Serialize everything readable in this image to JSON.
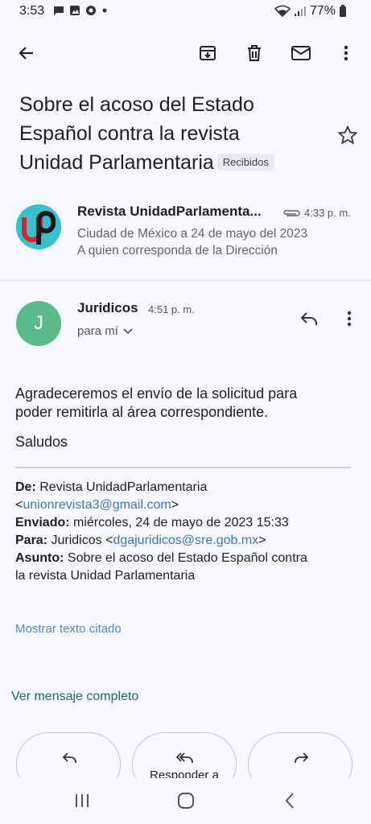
{
  "status": {
    "time": "3:53",
    "battery": "77%"
  },
  "toolbar": {
    "back": "arrow-back-icon",
    "archive": "archive-icon",
    "delete": "trash-icon",
    "mark_unread": "mail-icon",
    "more": "more-vert-icon"
  },
  "subject": {
    "lines": [
      "Sobre el acoso del Estado",
      "Español  contra  la revista",
      "Unidad Parlamentaria"
    ],
    "label": "Recibidos"
  },
  "message1": {
    "sender": "Revista UnidadParlamenta...",
    "time": "4:33 p. m.",
    "snippet_line1": "Ciudad de México a 24 de mayo del 2023",
    "snippet_line2": "A quien corresponda de la Dirección"
  },
  "message2": {
    "avatar_letter": "J",
    "sender": "Juridicos",
    "time": "4:51 p. m.",
    "to": "para mí",
    "body_line1": "Agradeceremos el envío de la solicitud para",
    "body_line2": "poder remitirla al área correspondiente.",
    "greeting": "Saludos",
    "quote": {
      "from_label": "De:",
      "from_name": "Revista UnidadParlamentaria",
      "from_email": "unionrevista3@gmail.com",
      "sent_label": "Enviado:",
      "sent_value": "miércoles, 24 de mayo de 2023 15:33",
      "to_label": "Para:",
      "to_name": "Juridicos",
      "to_email": "dgajuridicos@sre.gob.mx",
      "subject_label": "Asunto:",
      "subject_line1": "Sobre el acoso del Estado Español contra",
      "subject_line2": "la revista Unidad Parlamentaria"
    },
    "show_quoted": "Mostrar texto citado",
    "view_full": "Ver mensaje completo"
  },
  "actions": {
    "reply_all": "Responder a"
  },
  "colors": {
    "background": "#f7f8fd",
    "avatar_j": "#5aba88",
    "link": "#3a76c4",
    "teal_link": "#1a6b72"
  }
}
